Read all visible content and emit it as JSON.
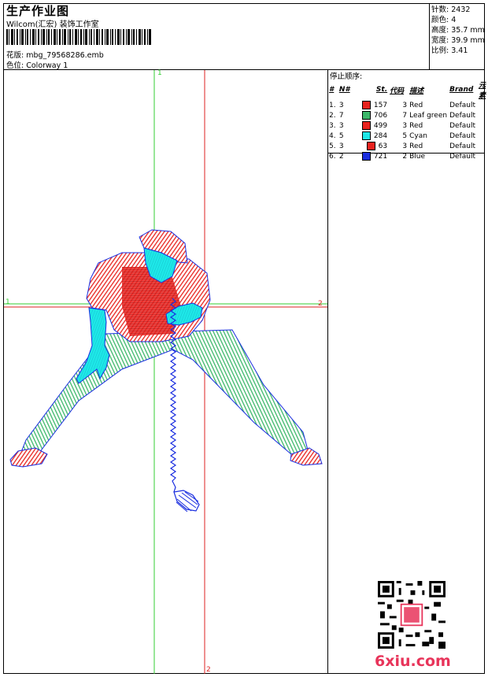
{
  "header": {
    "title": "生产作业图",
    "company": "Wilcom(汇宏) 装饰工作室",
    "design_label": "花版:",
    "design_file": "mbg_79568286.emb",
    "colorway_label": "色位:",
    "colorway": "Colorway 1"
  },
  "stats": [
    {
      "label": "针数:",
      "value": "2432"
    },
    {
      "label": "颜色:",
      "value": "4"
    },
    {
      "label": "高度:",
      "value": "35.7 mm"
    },
    {
      "label": "宽度:",
      "value": "39.9 mm"
    },
    {
      "label": "比例:",
      "value": "3.41"
    }
  ],
  "stop_sequence": {
    "label": "停止顺序:",
    "columns": [
      "#",
      "N#",
      "St.",
      "代码",
      "描述",
      "Brand",
      "元素"
    ],
    "rows": [
      {
        "num": "1.",
        "n": "3",
        "color": "#e8231f",
        "st": "157",
        "code": "3",
        "desc": "Red",
        "brand": "Default"
      },
      {
        "num": "2.",
        "n": "7",
        "color": "#3cb86a",
        "st": "706",
        "code": "7",
        "desc": "Leaf green",
        "brand": "Default"
      },
      {
        "num": "3.",
        "n": "3",
        "color": "#e8231f",
        "st": "499",
        "code": "3",
        "desc": "Red",
        "brand": "Default"
      },
      {
        "num": "4.",
        "n": "5",
        "color": "#1ee8e8",
        "st": "284",
        "code": "5",
        "desc": "Cyan",
        "brand": "Default"
      },
      {
        "num": "5.",
        "n": "3",
        "color": "#e8231f",
        "st": "63",
        "code": "3",
        "desc": "Red",
        "brand": "Default"
      },
      {
        "num": "6.",
        "n": "2",
        "color": "#1a2ee0",
        "st": "721",
        "code": "2",
        "desc": "Blue",
        "brand": "Default"
      }
    ]
  },
  "axes": {
    "v_green_label": "1",
    "h_green_label": "1",
    "h_red_label": "2",
    "v_red_label": "2"
  },
  "colors": {
    "red": "#e8231f",
    "green": "#3cb86a",
    "cyan": "#1ee8e8",
    "blue": "#1a2ee0",
    "axis_green": "#33cc33",
    "axis_red": "#dd2222"
  },
  "watermark": {
    "logo_text": "6xiu.com"
  }
}
